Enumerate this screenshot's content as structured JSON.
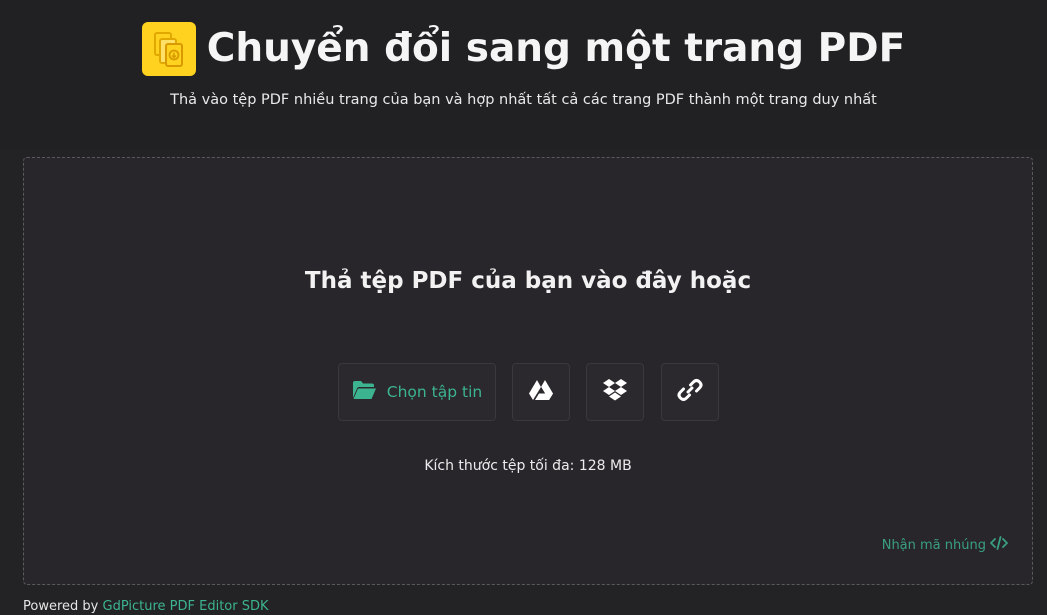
{
  "header": {
    "title": "Chuyển đổi sang một trang PDF",
    "subtitle": "Thả vào tệp PDF nhiều trang của bạn và hợp nhất tất cả các trang PDF thành một trang duy nhất",
    "logo_icon": "merge-pages-icon"
  },
  "dropzone": {
    "heading": "Thả tệp PDF của bạn vào đây hoặc",
    "choose_label": "Chọn tập tin",
    "choose_icon": "folder-open-icon",
    "sources": [
      {
        "icon": "google-drive-icon"
      },
      {
        "icon": "dropbox-icon"
      },
      {
        "icon": "link-icon"
      }
    ],
    "max_size": "Kích thước tệp tối đa: 128 MB",
    "embed_label": "Nhận mã nhúng",
    "embed_icon": "code-icon"
  },
  "footer": {
    "powered_prefix": "Powered by",
    "powered_link": "GdPicture PDF Editor SDK"
  },
  "colors": {
    "background": "#232224",
    "accent": "#3cb48f",
    "logo": "#ffd21f"
  }
}
